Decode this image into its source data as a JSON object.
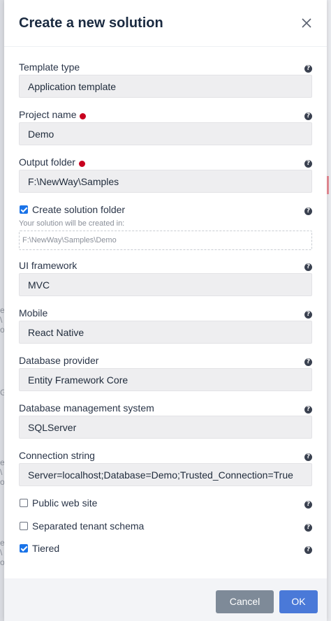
{
  "dialog": {
    "title": "Create a new solution",
    "close_icon": "close-icon"
  },
  "fields": {
    "template_type": {
      "label": "Template type",
      "value": "Application template"
    },
    "project_name": {
      "label": "Project name",
      "value": "Demo"
    },
    "output_folder": {
      "label": "Output folder",
      "value": "F:\\NewWay\\Samples"
    },
    "create_solution_folder": {
      "label": "Create solution folder",
      "checked": true,
      "hint": "Your solution will be created in:",
      "path": "F:\\NewWay\\Samples\\Demo"
    },
    "ui_framework": {
      "label": "UI framework",
      "value": "MVC"
    },
    "mobile": {
      "label": "Mobile",
      "value": "React Native"
    },
    "database_provider": {
      "label": "Database provider",
      "value": "Entity Framework Core"
    },
    "dbms": {
      "label": "Database management system",
      "value": "SQLServer"
    },
    "connection_string": {
      "label": "Connection string",
      "value": "Server=localhost;Database=Demo;Trusted_Connection=True"
    }
  },
  "options": {
    "public_web_site": {
      "label": "Public web site",
      "checked": false
    },
    "separated_tenant_schema": {
      "label": "Separated tenant schema",
      "checked": false
    },
    "tiered": {
      "label": "Tiered",
      "checked": true
    }
  },
  "help_icon": "?",
  "footer": {
    "cancel_label": "Cancel",
    "ok_label": "OK"
  },
  "colors": {
    "required_dot": "#c8001e",
    "primary_button": "#4a79d8",
    "secondary_button": "#7e8a98",
    "checkbox_checked": "#1a73e8"
  },
  "background_fragments": [
    "e",
    "\\",
    "o",
    "G",
    "e",
    "\\",
    "o",
    "e",
    "\\",
    "o",
    "e",
    "\\",
    "o"
  ]
}
